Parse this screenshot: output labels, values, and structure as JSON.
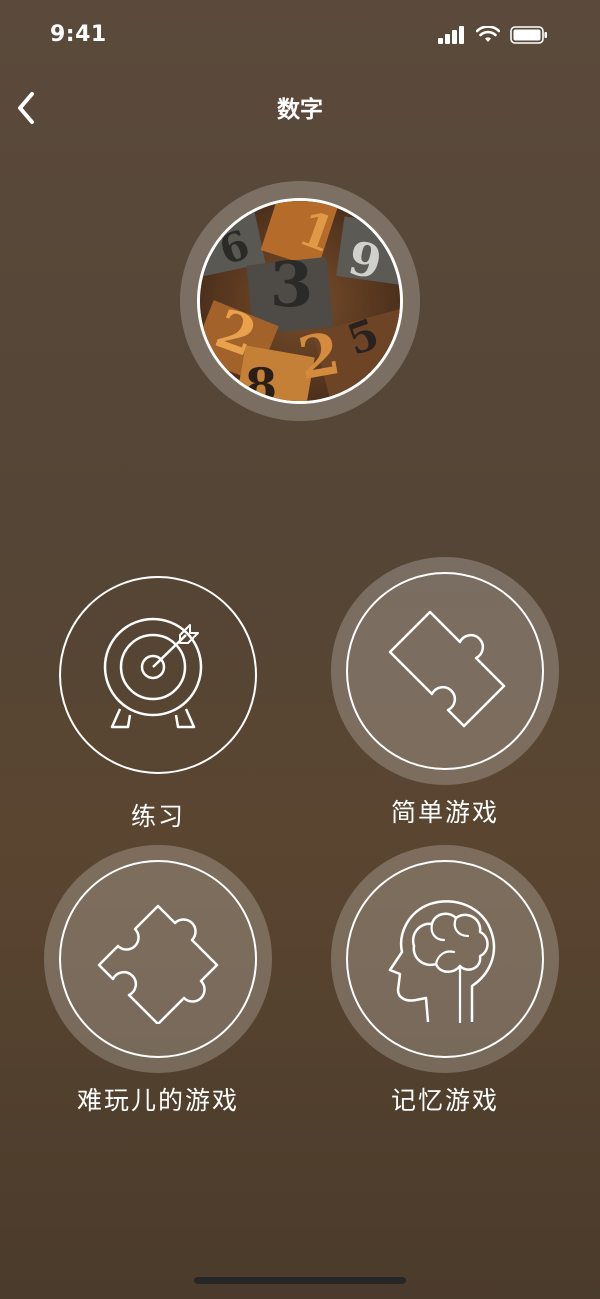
{
  "status_bar": {
    "time": "9:41",
    "icons": [
      "signal-icon",
      "wifi-icon",
      "battery-icon"
    ]
  },
  "header": {
    "title": "数字",
    "back_icon": "chevron-left-icon"
  },
  "hero": {
    "image": "wooden-letterpress-numbers"
  },
  "tiles": [
    {
      "label": "练习",
      "icon": "target-icon"
    },
    {
      "label": "简单游戏",
      "icon": "puzzle-piece-icon"
    },
    {
      "label": "难玩儿的游戏",
      "icon": "puzzle-pieces-icon"
    },
    {
      "label": "记忆游戏",
      "icon": "brain-head-icon"
    }
  ],
  "colors": {
    "background": "#56473a",
    "foreground": "#ffffff",
    "halo": "rgba(255,255,255,0.22)",
    "home_indicator": "#262626"
  }
}
